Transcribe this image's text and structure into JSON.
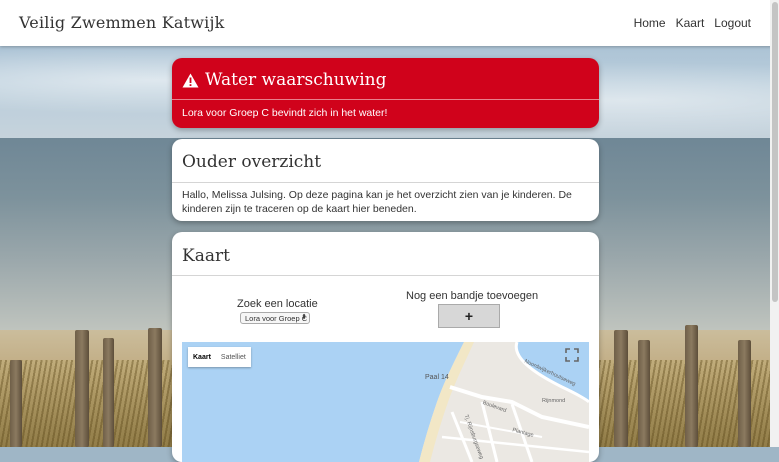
{
  "navbar": {
    "brand": "Veilig Zwemmen Katwijk",
    "links": [
      "Home",
      "Kaart",
      "Logout"
    ]
  },
  "alert": {
    "icon": "warning-icon",
    "title": "Water waarschuwing",
    "message": "Lora voor Groep C bevindt zich in het water!",
    "color": "#d0021b"
  },
  "overview": {
    "title": "Ouder overzicht",
    "text": "Hallo, Melissa Julsing. Op deze pagina kan je het overzicht zien van je kinderen. De kinderen zijn te traceren op de kaart hier beneden."
  },
  "kaart": {
    "title": "Kaart",
    "search_label": "Zoek een locatie",
    "select_value": "Lora voor Groep C",
    "add_label": "Nog een bandje toevoegen",
    "add_button": "+",
    "map": {
      "type_map": "Kaart",
      "type_satellite": "Satelliet",
      "poi": "Paal 14",
      "streets": [
        "Rijnmond",
        "Boulevard",
        "Plantage",
        "Noordwijkerhoutseweg",
        "Tj. Rijnsburgseweg"
      ]
    }
  }
}
